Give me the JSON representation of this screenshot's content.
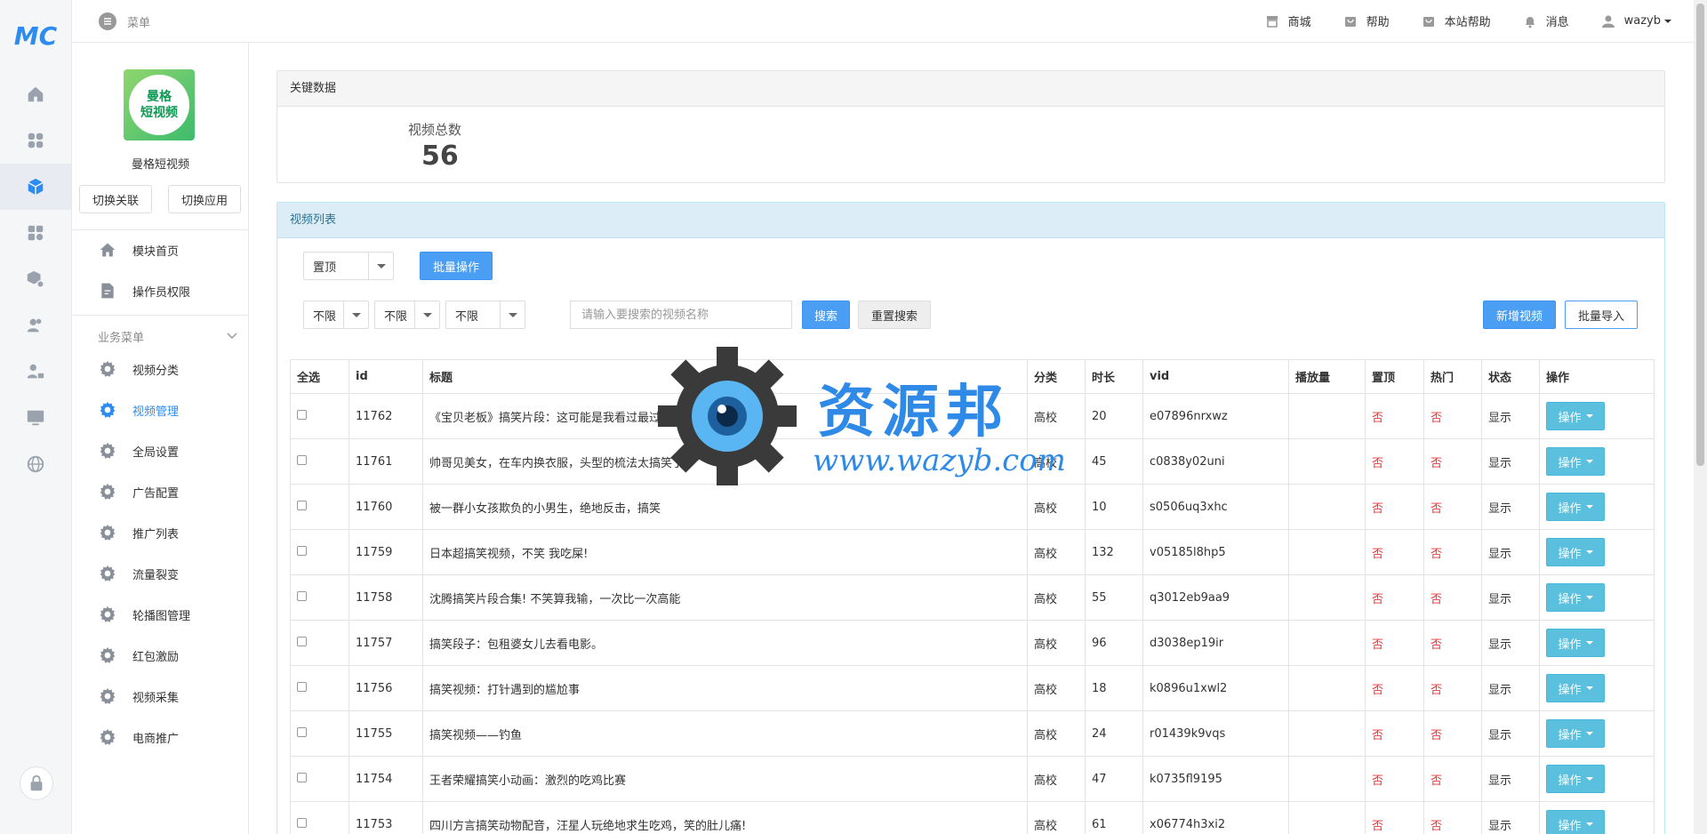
{
  "topbar": {
    "menu_label": "菜单",
    "links": [
      {
        "label": "商城",
        "icon": "shop-icon"
      },
      {
        "label": "帮助",
        "icon": "help-bag-icon"
      },
      {
        "label": "本站帮助",
        "icon": "site-help-bag-icon"
      },
      {
        "label": "消息",
        "icon": "bell-icon"
      },
      {
        "label": "wazyb",
        "icon": "user-icon"
      }
    ]
  },
  "rail": {
    "logo": "MC",
    "icons": [
      "home-icon",
      "apps-icon",
      "cube-icon",
      "modules-icon",
      "package-settings-icon",
      "users-icon",
      "user-lock-icon",
      "monitor-icon",
      "globe-icon"
    ],
    "active_index": 2,
    "bottom_icon": "lock-icon"
  },
  "sidebar": {
    "app_logo_text": "曼格\n短视频",
    "app_name": "曼格短视频",
    "switch_link_label": "切换关联",
    "switch_app_label": "切换应用",
    "top_items": [
      {
        "label": "模块首页",
        "icon": "home-icon"
      },
      {
        "label": "操作员权限",
        "icon": "edit-doc-icon"
      }
    ],
    "group_label": "业务菜单",
    "items": [
      {
        "label": "视频分类"
      },
      {
        "label": "视频管理",
        "active": true
      },
      {
        "label": "全局设置"
      },
      {
        "label": "广告配置"
      },
      {
        "label": "推广列表"
      },
      {
        "label": "流量裂变"
      },
      {
        "label": "轮播图管理"
      },
      {
        "label": "红包激励"
      },
      {
        "label": "视频采集"
      },
      {
        "label": "电商推广"
      }
    ]
  },
  "key_data": {
    "title": "关键数据",
    "stat_label": "视频总数",
    "stat_value": "56"
  },
  "video_list": {
    "title": "视频列表",
    "batch_select_value": "置顶",
    "batch_button": "批量操作",
    "filters": [
      "不限",
      "不限",
      "不限"
    ],
    "search_placeholder": "请输入要搜索的视频名称",
    "search_button": "搜索",
    "reset_button": "重置搜索",
    "add_button": "新增视频",
    "import_button": "批量导入",
    "columns": [
      "全选",
      "id",
      "标题",
      "分类",
      "时长",
      "vid",
      "播放量",
      "置顶",
      "热门",
      "状态",
      "操作"
    ],
    "op_label": "操作",
    "rows": [
      {
        "id": "11762",
        "title": "《宝贝老板》搞笑片段：这可能是我看过最过分的保姆了吧!",
        "category": "高校",
        "duration": "20",
        "vid": "e07896nrxwz",
        "plays": "",
        "top": "否",
        "hot": "否",
        "status": "显示"
      },
      {
        "id": "11761",
        "title": "帅哥见美女，在车内换衣服，头型的梳法太搞笑了!",
        "category": "高校",
        "duration": "45",
        "vid": "c0838y02uni",
        "plays": "",
        "top": "否",
        "hot": "否",
        "status": "显示"
      },
      {
        "id": "11760",
        "title": "被一群小女孩欺负的小男生，绝地反击，搞笑",
        "category": "高校",
        "duration": "10",
        "vid": "s0506uq3xhc",
        "plays": "",
        "top": "否",
        "hot": "否",
        "status": "显示"
      },
      {
        "id": "11759",
        "title": "日本超搞笑视频，不笑 我吃屎!",
        "category": "高校",
        "duration": "132",
        "vid": "v05185l8hp5",
        "plays": "",
        "top": "否",
        "hot": "否",
        "status": "显示"
      },
      {
        "id": "11758",
        "title": "沈腾搞笑片段合集! 不笑算我输，一次比一次高能",
        "category": "高校",
        "duration": "55",
        "vid": "q3012eb9aa9",
        "plays": "",
        "top": "否",
        "hot": "否",
        "status": "显示"
      },
      {
        "id": "11757",
        "title": "搞笑段子：包租婆女儿去看电影。",
        "category": "高校",
        "duration": "96",
        "vid": "d3038ep19ir",
        "plays": "",
        "top": "否",
        "hot": "否",
        "status": "显示"
      },
      {
        "id": "11756",
        "title": "搞笑视频：打针遇到的尴尬事",
        "category": "高校",
        "duration": "18",
        "vid": "k0896u1xwl2",
        "plays": "",
        "top": "否",
        "hot": "否",
        "status": "显示"
      },
      {
        "id": "11755",
        "title": "搞笑视频——钓鱼",
        "category": "高校",
        "duration": "24",
        "vid": "r01439k9vqs",
        "plays": "",
        "top": "否",
        "hot": "否",
        "status": "显示"
      },
      {
        "id": "11754",
        "title": "王者荣耀搞笑小动画：激烈的吃鸡比赛",
        "category": "高校",
        "duration": "47",
        "vid": "k0735fl9195",
        "plays": "",
        "top": "否",
        "hot": "否",
        "status": "显示"
      },
      {
        "id": "11753",
        "title": "四川方言搞笑动物配音，汪星人玩绝地求生吃鸡，笑的肚儿痛!",
        "category": "高校",
        "duration": "61",
        "vid": "x06774h3xi2",
        "plays": "",
        "top": "否",
        "hot": "否",
        "status": "显示"
      }
    ]
  },
  "watermark": {
    "text": "资源邦",
    "url": "www.wazyb.com"
  }
}
